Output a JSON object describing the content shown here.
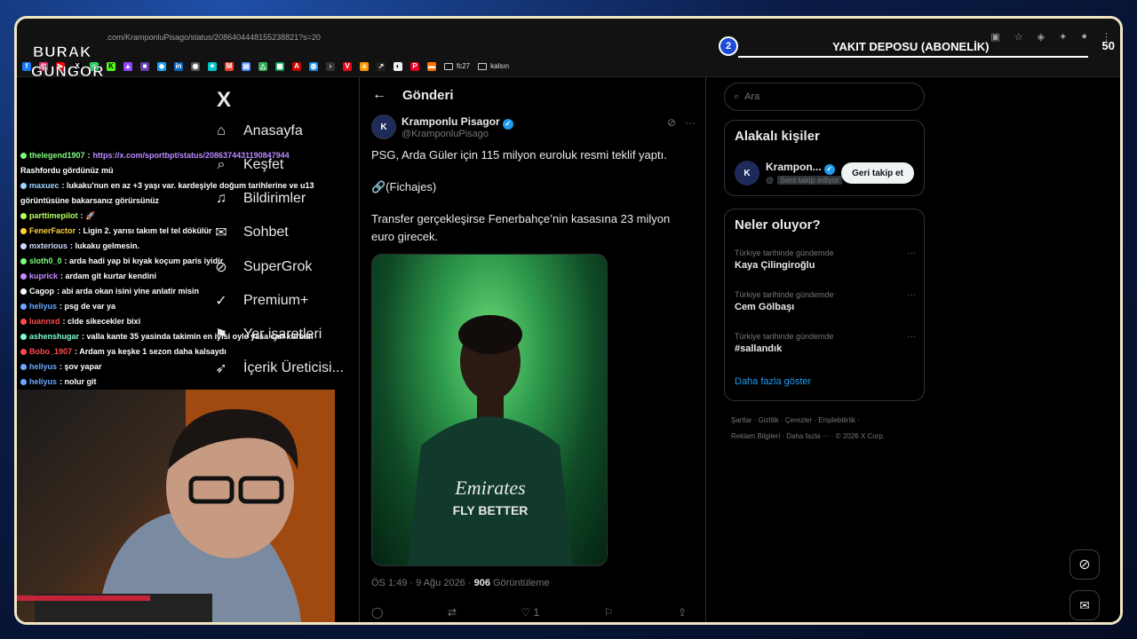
{
  "browser": {
    "url": ".com/KramponluPisago/status/2086404448155238821?s=20",
    "bookmark_folders": [
      "fc27",
      "kalsın"
    ]
  },
  "overlay": {
    "logo_line1": "BURAK",
    "logo_line2": "GUNGOR",
    "sub_goal_badge": "2",
    "sub_goal_title": "YAKIT DEPOSU (ABONELİK)",
    "sub_goal_count": "50",
    "webcam_more": "···"
  },
  "nav": {
    "logo": "X",
    "items": [
      {
        "icon": "home-icon",
        "label": "Anasayfa"
      },
      {
        "icon": "search-icon",
        "label": "Keşfet"
      },
      {
        "icon": "bell-icon",
        "label": "Bildirimler"
      },
      {
        "icon": "chat-icon",
        "label": "Sohbet"
      },
      {
        "icon": "grok-icon",
        "label": "SuperGrok"
      },
      {
        "icon": "premium-icon",
        "label": "Premium+"
      },
      {
        "icon": "bookmark-icon",
        "label": "Yer işaretleri"
      },
      {
        "icon": "rocket-icon",
        "label": "İçerik Üreticisi..."
      }
    ]
  },
  "post": {
    "header_title": "Gönderi",
    "author_name": "Kramponlu Pisagor",
    "author_handle": "@KramponluPisago",
    "text_1": "PSG, Arda Güler için 115 milyon euroluk resmi teklif yaptı.",
    "text_2": "🔗(Fichajes)",
    "text_3": "Transfer gerçekleşirse Fenerbahçe’nin kasasına 23 milyon euro girecek.",
    "time": "ÖS 1:49 · 9 Ağu 2026 · ",
    "views_count": "906",
    "views_label": " Görüntüleme",
    "like_count": "1",
    "image_jersey_line1": "Emirates",
    "image_jersey_line2": "FLY BETTER"
  },
  "right": {
    "search_placeholder": "Ara",
    "related_title": "Alakalı kişiler",
    "related_name": "Krampon...",
    "related_handle": "@",
    "related_follows_you": "Seni takip ediyor",
    "follow_back_label": "Geri takip et",
    "trends_title": "Neler oluyor?",
    "trends": [
      {
        "context": "Türkiye tarihinde gündemde",
        "name": "Kaya Çilingiroğlu"
      },
      {
        "context": "Türkiye tarihinde gündemde",
        "name": "Cem Gölbaşı"
      },
      {
        "context": "Türkiye tarihinde gündemde",
        "name": "#sallandık"
      }
    ],
    "show_more": "Daha fazla göster",
    "footer_line1": "Şartlar · Gizlilik · Çerezler · Erişilebilirlik ·",
    "footer_line2": "Reklam Bilgileri · Daha fazla ··· · © 2026 X Corp."
  },
  "chat": [
    {
      "user": "thelegend1907",
      "color": "#7fff7f",
      "text": ": ",
      "link": "https://x.com/sportbpt/status/2086374431190847944"
    },
    {
      "user": "",
      "color": "#ffffff",
      "text": "Rashfordu gördünüz mü",
      "link": ""
    },
    {
      "user": "maxuec",
      "color": "#9ad7ff",
      "text": ": lukaku'nun en az +3 yaşı var. kardeşiyle doğum tarihlerine ve u13",
      "link": ""
    },
    {
      "user": "",
      "color": "#ffffff",
      "text": "görüntüsüne bakarsanız görürsünüz",
      "link": ""
    },
    {
      "user": "parttimepilot",
      "color": "#b8ff66",
      "text": ": 🚀",
      "link": ""
    },
    {
      "user": "FenerFactor",
      "color": "#ffd23a",
      "text": ": Ligin 2. yarısı takım tel tel dökülür",
      "link": ""
    },
    {
      "user": "mxterious",
      "color": "#cfd8ff",
      "text": ": lukaku gelmesin.",
      "link": ""
    },
    {
      "user": "sloth0_0",
      "color": "#7fff7f",
      "text": ": arda hadi yap bi kıyak koçum paris iyidir",
      "link": ""
    },
    {
      "user": "kuprick",
      "color": "#c58cff",
      "text": ": ardam git kurtar kendini",
      "link": ""
    },
    {
      "user": "Cagop",
      "color": "#ffffff",
      "text": ": abi arda okan isini yine anlatir misin",
      "link": ""
    },
    {
      "user": "heliyus",
      "color": "#6aa8ff",
      "text": ": psg de var ya",
      "link": ""
    },
    {
      "user": "luannxd",
      "color": "#ff4a4a",
      "text": ": clde sikecekler bixi",
      "link": ""
    },
    {
      "user": "ashenshugar",
      "color": "#7fffd4",
      "text": ": valla kante 35 yasinda takimin en iyisi oyle yasa can kurban",
      "link": ""
    },
    {
      "user": "Bobo_1907",
      "color": "#ff4a4a",
      "text": ": Ardam ya keşke 1 sezon daha kalsaydı",
      "link": ""
    },
    {
      "user": "heliyus",
      "color": "#6aa8ff",
      "text": ": şov yapar",
      "link": ""
    },
    {
      "user": "heliyus",
      "color": "#6aa8ff",
      "text": ": nolur git",
      "link": ""
    }
  ]
}
